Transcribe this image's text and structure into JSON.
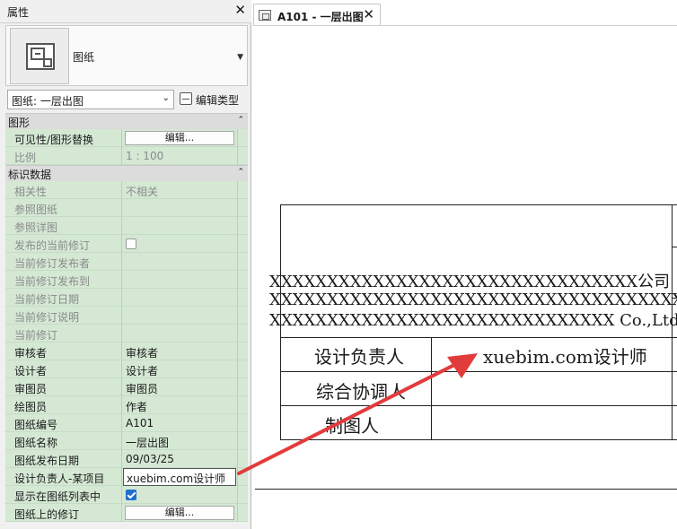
{
  "properties_panel": {
    "title": "属性",
    "type_name": "图纸",
    "instance_selector": "图纸: 一层出图",
    "edit_type_label": "编辑类型",
    "groups": [
      {
        "name": "图形",
        "rows": [
          {
            "key": "可见性/图形替换",
            "value": "编辑...",
            "kind": "button"
          },
          {
            "key": "比例",
            "value": "1 : 100",
            "kind": "dim"
          }
        ]
      },
      {
        "name": "标识数据",
        "rows": [
          {
            "key": "相关性",
            "value": "不相关",
            "kind": "dim"
          },
          {
            "key": "参照图纸",
            "value": "",
            "kind": "dim"
          },
          {
            "key": "参照详图",
            "value": "",
            "kind": "dim"
          },
          {
            "key": "发布的当前修订",
            "value": "",
            "kind": "checkbox-off-dim"
          },
          {
            "key": "当前修订发布者",
            "value": "",
            "kind": "dim"
          },
          {
            "key": "当前修订发布到",
            "value": "",
            "kind": "dim"
          },
          {
            "key": "当前修订日期",
            "value": "",
            "kind": "dim"
          },
          {
            "key": "当前修订说明",
            "value": "",
            "kind": "dim"
          },
          {
            "key": "当前修订",
            "value": "",
            "kind": "dim"
          },
          {
            "key": "审核者",
            "value": "审核者",
            "kind": "text"
          },
          {
            "key": "设计者",
            "value": "设计者",
            "kind": "text"
          },
          {
            "key": "审图员",
            "value": "审图员",
            "kind": "text"
          },
          {
            "key": "绘图员",
            "value": "作者",
            "kind": "text"
          },
          {
            "key": "图纸编号",
            "value": "A101",
            "kind": "text"
          },
          {
            "key": "图纸名称",
            "value": "一层出图",
            "kind": "text"
          },
          {
            "key": "图纸发布日期",
            "value": "09/03/25",
            "kind": "text"
          },
          {
            "key": "设计负责人-某项目",
            "value": "xuebim.com设计师",
            "kind": "selected"
          },
          {
            "key": "显示在图纸列表中",
            "value": "",
            "kind": "checkbox-on"
          },
          {
            "key": "图纸上的修订",
            "value": "编辑...",
            "kind": "button"
          }
        ]
      }
    ]
  },
  "document_tab": {
    "label": "A101 - 一层出图"
  },
  "title_block": {
    "company_lines": [
      "XXXXXXXXXXXXXXXXXXXXXXXXXXXXXXXX公司",
      "XXXXXXXXXXXXXXXXXXXXXXXXXXXXXXXXXXXXXX",
      "XXXXXXXXXXXXXXXXXXXXXXXXXXXXXX Co.,Ltd"
    ],
    "rows": [
      {
        "label": "设计负责人",
        "value": "xuebim.com设计师"
      },
      {
        "label": "综合协调人",
        "value": ""
      },
      {
        "label": "制图人",
        "value": ""
      }
    ]
  },
  "annotation": {
    "arrow_color": "#e23b3b"
  },
  "icons": {
    "sheet_thumbnail": "sheet-icon",
    "close": "close-icon",
    "edit_type": "edit-type-icon",
    "tab_sheet": "sheet-tab-icon"
  }
}
